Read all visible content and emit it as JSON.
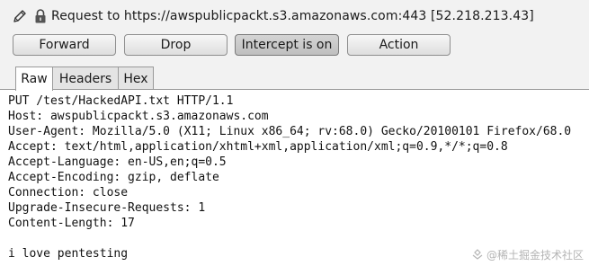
{
  "header": {
    "title": "Request to https://awspublicpackt.s3.amazonaws.com:443  [52.218.213.43]"
  },
  "toolbar": {
    "forward": "Forward",
    "drop": "Drop",
    "intercept": "Intercept is on",
    "action": "Action"
  },
  "tabs": [
    "Raw",
    "Headers",
    "Hex"
  ],
  "request": {
    "lines": [
      "PUT /test/HackedAPI.txt HTTP/1.1",
      "Host: awspublicpackt.s3.amazonaws.com",
      "User-Agent: Mozilla/5.0 (X11; Linux x86_64; rv:68.0) Gecko/20100101 Firefox/68.0",
      "Accept: text/html,application/xhtml+xml,application/xml;q=0.9,*/*;q=0.8",
      "Accept-Language: en-US,en;q=0.5",
      "Accept-Encoding: gzip, deflate",
      "Connection: close",
      "Upgrade-Insecure-Requests: 1",
      "Content-Length: 17",
      "",
      "i love pentesting"
    ]
  },
  "watermark": "@稀土掘金技术社区",
  "icons": {
    "edit": "pencil-icon",
    "lock": "lock-icon"
  }
}
